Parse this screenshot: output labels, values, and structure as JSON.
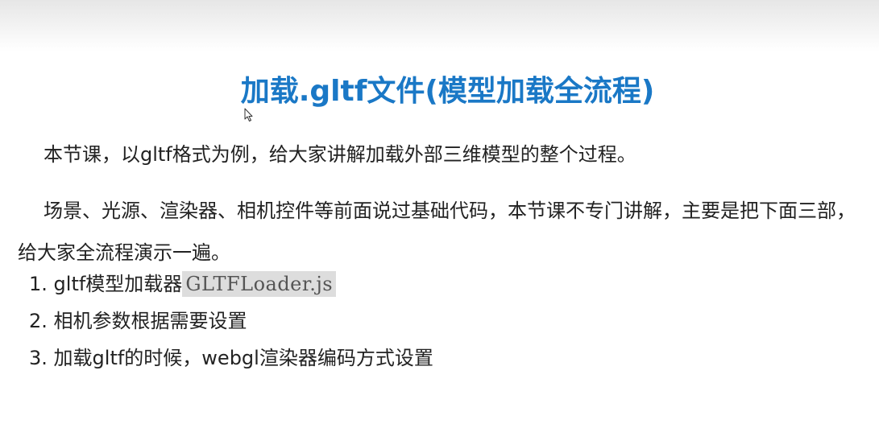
{
  "title": "加载.gltf文件(模型加载全流程)",
  "paragraphs": [
    "本节课，以gltf格式为例，给大家讲解加载外部三维模型的整个过程。",
    "场景、光源、渲染器、相机控件等前面说过基础代码，本节课不专门讲解，主要是把下面三部，给大家全流程演示一遍。"
  ],
  "steps": [
    {
      "number": "1.",
      "text": "gltf模型加载器",
      "code": "GLTFLoader.js"
    },
    {
      "number": "2.",
      "text": "相机参数根据需要设置",
      "code": ""
    },
    {
      "number": "3.",
      "text": "加载gltf的时候，webgl渲染器编码方式设置",
      "code": ""
    }
  ],
  "icons": {
    "cursor": "mouse-pointer-icon"
  },
  "colors": {
    "title": "#1a78c6",
    "text": "#222222",
    "code_background": "#dddddd",
    "code_text": "#555555"
  }
}
